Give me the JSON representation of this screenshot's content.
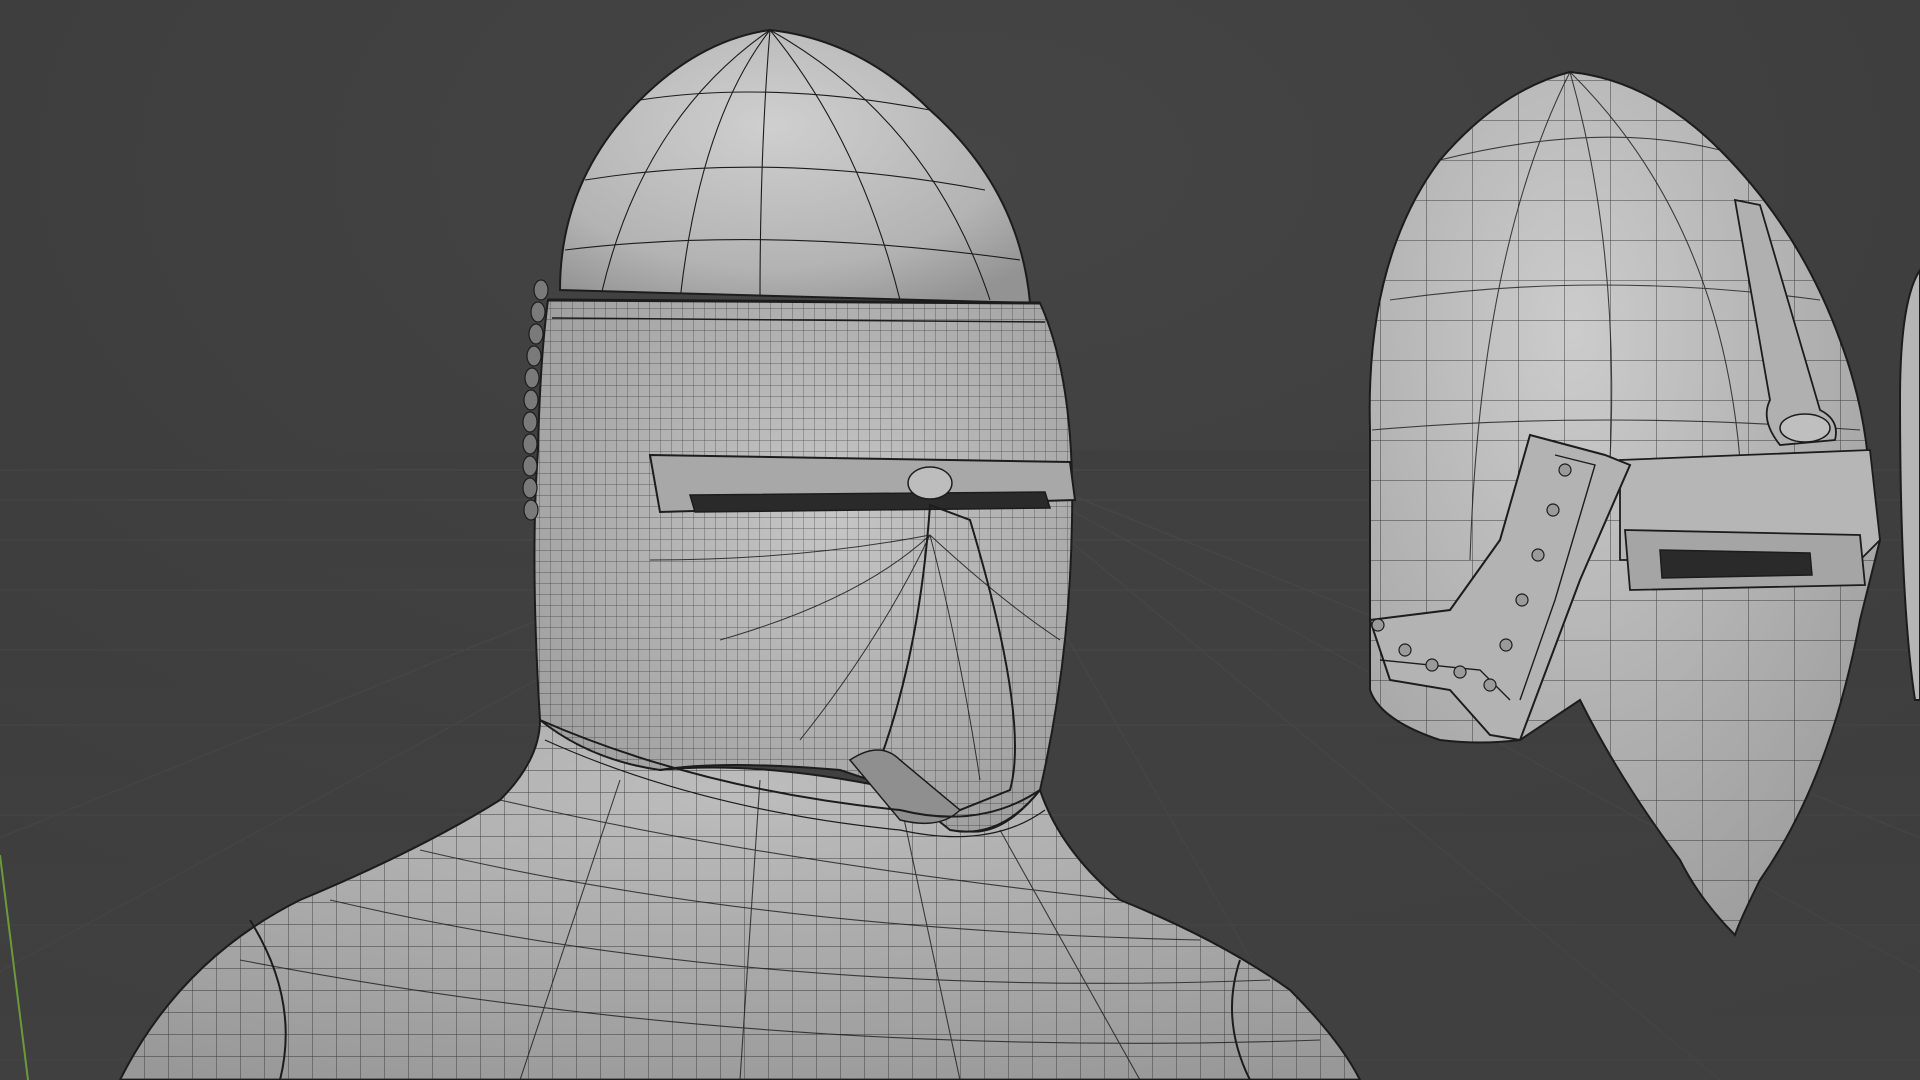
{
  "app": {
    "name": "3D Viewport",
    "view": "solid-wireframe"
  },
  "scene": {
    "background_color": "#3d3d3d",
    "floor_grid_color": "#4a4a4a",
    "mesh_color": "#b9b9b9",
    "mesh_shadow_color": "#8c8c8c",
    "wire_color": "#1c1c1c",
    "y_axis_color": "#6a9a3a",
    "objects": [
      {
        "id": "helmet-bascinet-closed",
        "name": "bascinet-with-visor-icon"
      },
      {
        "id": "helmet-side",
        "name": "bascinet-side-view-icon"
      },
      {
        "id": "knight-bust",
        "name": "neck-shoulders-mesh-icon"
      },
      {
        "id": "partial-helmet-edge",
        "name": "partial-helmet-edge-icon"
      }
    ]
  }
}
